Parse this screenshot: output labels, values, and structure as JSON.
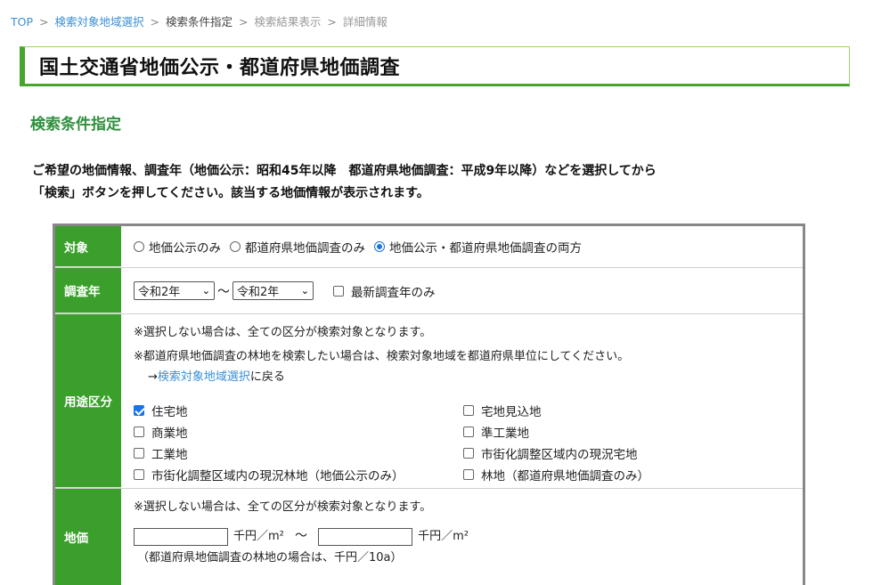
{
  "breadcrumb": {
    "top": "TOP",
    "area": "検索対象地域選択",
    "condition": "検索条件指定",
    "results": "検索結果表示",
    "detail": "詳細情報",
    "sep": ">"
  },
  "page_title": "国土交通省地価公示・都道府県地価調査",
  "section_title": "検索条件指定",
  "intro": {
    "line1": "ご希望の地価情報、調査年（地価公示：昭和45年以降　都道府県地価調査：平成9年以降）などを選択してから",
    "line2": "「検索」ボタンを押してください。該当する地価情報が表示されます。"
  },
  "form": {
    "target": {
      "label": "対象",
      "options": [
        {
          "label": "地価公示のみ",
          "selected": false
        },
        {
          "label": "都道府県地価調査のみ",
          "selected": false
        },
        {
          "label": "地価公示・都道府県地価調査の両方",
          "selected": true
        }
      ]
    },
    "year": {
      "label": "調査年",
      "from": "令和2年",
      "tilde": "〜",
      "to": "令和2年",
      "latest_label": "最新調査年のみ",
      "latest_checked": false
    },
    "use": {
      "label": "用途区分",
      "note1": "※選択しない場合は、全ての区分が検索対象となります。",
      "note2": "※都道府県地価調査の林地を検索したい場合は、検索対象地域を都道府県単位にしてください。",
      "back_arrow": "→",
      "back_link": "検索対象地域選択",
      "back_suffix": "に戻る",
      "options": [
        {
          "label": "住宅地",
          "checked": true
        },
        {
          "label": "宅地見込地",
          "checked": false
        },
        {
          "label": "商業地",
          "checked": false
        },
        {
          "label": "準工業地",
          "checked": false
        },
        {
          "label": "工業地",
          "checked": false
        },
        {
          "label": "市街化調整区域内の現況宅地",
          "checked": false
        },
        {
          "label": "市街化調整区域内の現況林地（地価公示のみ）",
          "checked": false
        },
        {
          "label": "林地（都道府県地価調査のみ）",
          "checked": false
        }
      ]
    },
    "price": {
      "label": "地価",
      "note": "※選択しない場合は、全ての区分が検索対象となります。",
      "unit": "千円／m²",
      "tilde": "〜",
      "forest_note": "（都道府県地価調査の林地の場合は、千円／10a）",
      "from_value": "",
      "to_value": ""
    }
  },
  "colors": {
    "accent_green": "#3aa02b",
    "title_green": "#2f8f3c",
    "link_blue": "#3a8fd6",
    "control_blue": "#1a73e8"
  }
}
